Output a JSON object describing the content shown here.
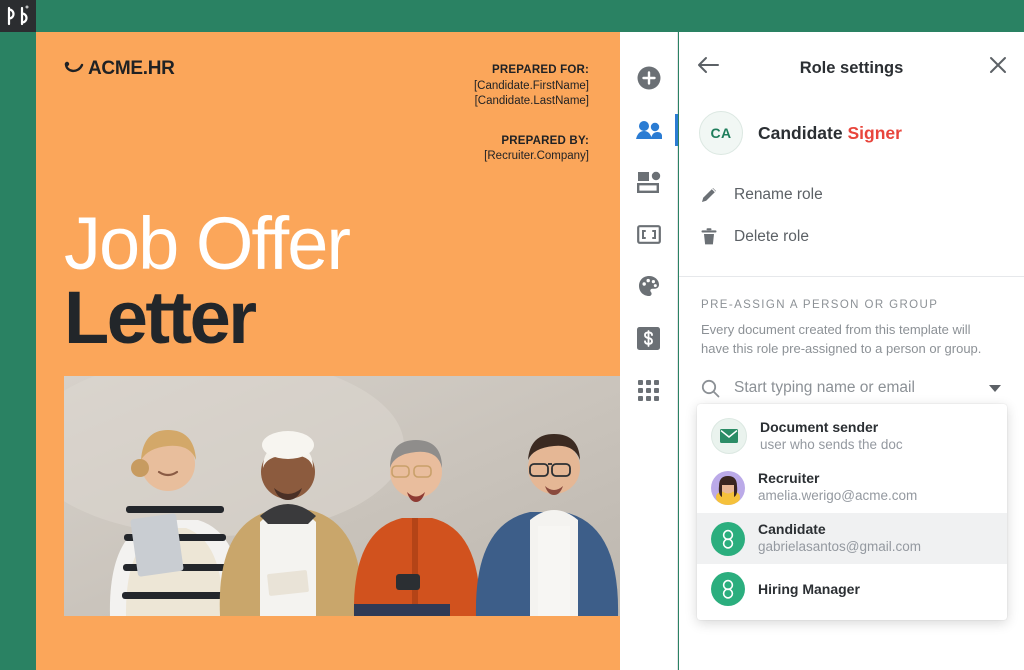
{
  "brand": {
    "app_logo": "pandadoc-logo",
    "green": "#2A8263",
    "orange": "#FBA65A",
    "accent_red": "#E8453C",
    "accent_blue": "#2B7CD3",
    "avatar_green": "#2BAE7E"
  },
  "document": {
    "logo_text": "ACME.HR",
    "logo_mark": "smile-swoosh-icon",
    "prepared_for_label": "PREPARED FOR:",
    "prepared_for_lines": [
      "[Candidate.FirstName]",
      "[Candidate.LastName]"
    ],
    "prepared_by_label": "PREPARED BY:",
    "prepared_by_lines": [
      "[Recruiter.Company]"
    ],
    "title_line1": "Job Offer",
    "title_line2": "Letter",
    "photo_alt": "four colleagues smiling against a grey wall"
  },
  "rail": {
    "items": [
      {
        "name": "add-content-button",
        "icon": "plus-circle-icon",
        "active": false
      },
      {
        "name": "recipients-button",
        "icon": "people-icon",
        "active": true
      },
      {
        "name": "content-library-button",
        "icon": "content-blocks-icon",
        "active": false
      },
      {
        "name": "fields-button",
        "icon": "field-brackets-icon",
        "active": false
      },
      {
        "name": "theme-button",
        "icon": "palette-icon",
        "active": false
      },
      {
        "name": "pricing-button",
        "icon": "dollar-square-icon",
        "active": false
      },
      {
        "name": "apps-button",
        "icon": "grid-apps-icon",
        "active": false
      }
    ]
  },
  "panel": {
    "title": "Role settings",
    "back_icon": "arrow-left-icon",
    "close_icon": "close-icon",
    "role": {
      "initials": "CA",
      "name": "Candidate",
      "tag": "Signer"
    },
    "menu": [
      {
        "label": "Rename role",
        "icon": "pencil-icon"
      },
      {
        "label": "Delete role",
        "icon": "trash-icon"
      }
    ],
    "preassign": {
      "label": "PRE-ASSIGN A PERSON OR GROUP",
      "description": "Every document created from this template will have this role pre-assigned to a person or group."
    },
    "search": {
      "placeholder": "Start typing name or email",
      "value": "",
      "icon": "search-icon",
      "caret_icon": "chevron-down-icon"
    },
    "dropdown": {
      "options": [
        {
          "name": "Document sender",
          "sub": "user who sends the doc",
          "avatar": "envelope-icon",
          "selected": false
        },
        {
          "name": "Recruiter",
          "sub": "amelia.werigo@acme.com",
          "avatar": "photo-avatar",
          "selected": false
        },
        {
          "name": "Candidate",
          "sub": "gabrielasantos@gmail.com",
          "avatar": "g-avatar",
          "selected": true
        },
        {
          "name": "Hiring Manager",
          "sub": "",
          "avatar": "g-avatar",
          "selected": false
        }
      ]
    }
  }
}
